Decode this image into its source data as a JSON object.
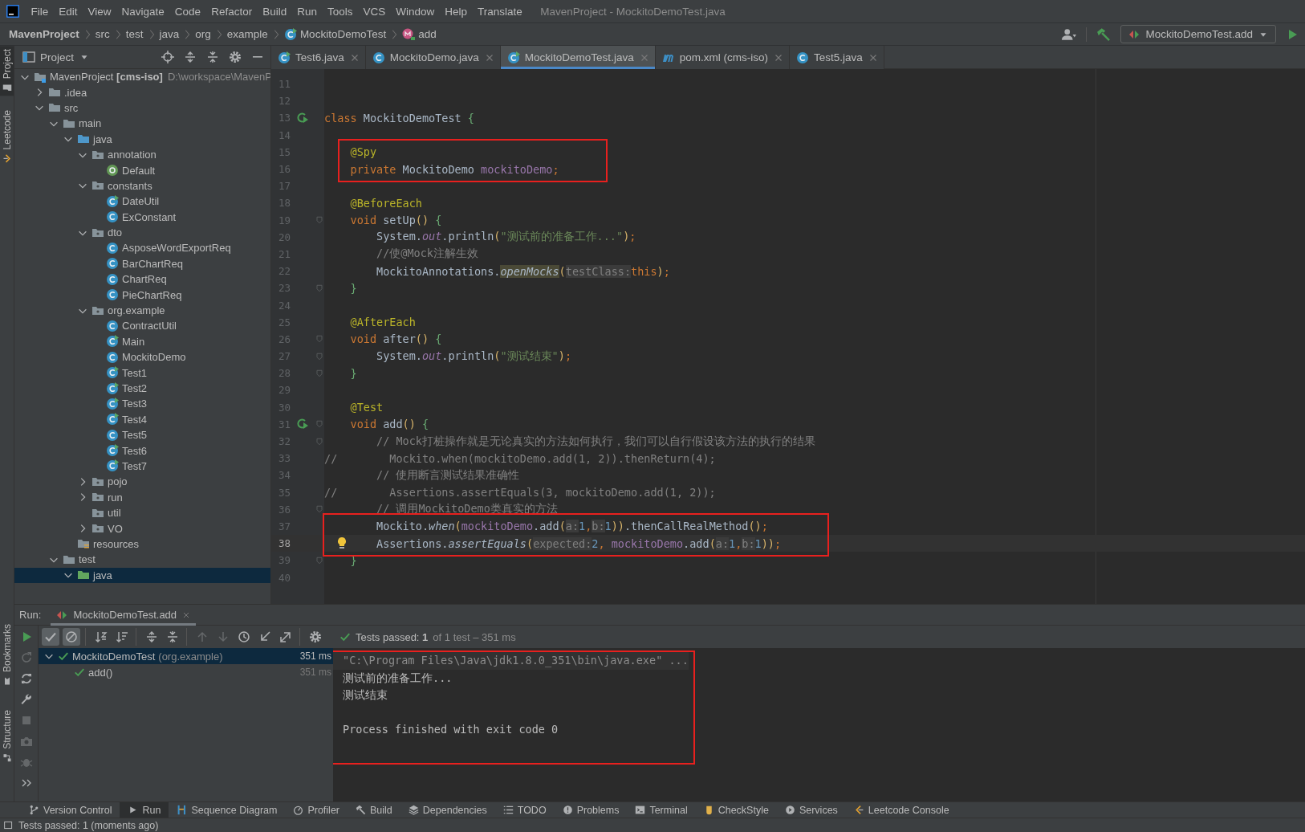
{
  "menu": {
    "items": [
      "File",
      "Edit",
      "View",
      "Navigate",
      "Code",
      "Refactor",
      "Build",
      "Run",
      "Tools",
      "VCS",
      "Window",
      "Help",
      "Translate"
    ],
    "title": "MavenProject - MockitoDemoTest.java"
  },
  "navbar": {
    "crumbs": [
      {
        "label": "MavenProject",
        "kind": "project"
      },
      {
        "label": "src",
        "kind": "folder"
      },
      {
        "label": "test",
        "kind": "folder"
      },
      {
        "label": "java",
        "kind": "folder"
      },
      {
        "label": "org",
        "kind": "folder"
      },
      {
        "label": "example",
        "kind": "folder"
      },
      {
        "label": "MockitoDemoTest",
        "kind": "class"
      },
      {
        "label": "add",
        "kind": "method"
      }
    ],
    "run_config": "MockitoDemoTest.add"
  },
  "side_strip": {
    "top": [
      {
        "label": "Project",
        "kind": "project",
        "selected": true
      },
      {
        "label": "Leetcode",
        "kind": "leetcode",
        "selected": false
      }
    ],
    "bottom": [
      {
        "label": "Bookmarks",
        "kind": "bookmark",
        "selected": false
      },
      {
        "label": "Structure",
        "kind": "structure",
        "selected": false
      }
    ]
  },
  "project": {
    "title": "Project",
    "tree": [
      {
        "label": "MavenProject **[cms-iso]**",
        "hint": "D:\\workspace\\MavenP",
        "kind": "module",
        "expanded": true,
        "selected": false,
        "children": [
          {
            "label": ".idea",
            "kind": "folder",
            "expanded": false,
            "selected": false
          },
          {
            "label": "src",
            "kind": "folder",
            "expanded": true,
            "selected": false,
            "children": [
              {
                "label": "main",
                "kind": "folder",
                "expanded": true,
                "selected": false,
                "children": [
                  {
                    "label": "java",
                    "kind": "source",
                    "expanded": true,
                    "selected": false,
                    "children": [
                      {
                        "label": "annotation",
                        "kind": "package",
                        "expanded": true,
                        "selected": false,
                        "children": [
                          {
                            "label": "Default",
                            "kind": "annotation",
                            "selected": false
                          }
                        ]
                      },
                      {
                        "label": "constants",
                        "kind": "package",
                        "expanded": true,
                        "selected": false,
                        "children": [
                          {
                            "label": "DateUtil",
                            "kind": "class",
                            "runnable": true,
                            "selected": false
                          },
                          {
                            "label": "ExConstant",
                            "kind": "class",
                            "runnable": false,
                            "selected": false
                          }
                        ]
                      },
                      {
                        "label": "dto",
                        "kind": "package",
                        "expanded": true,
                        "selected": false,
                        "children": [
                          {
                            "label": "AsposeWordExportReq",
                            "kind": "class",
                            "runnable": false,
                            "selected": false
                          },
                          {
                            "label": "BarChartReq",
                            "kind": "class",
                            "runnable": false,
                            "selected": false
                          },
                          {
                            "label": "ChartReq",
                            "kind": "class",
                            "runnable": false,
                            "selected": false
                          },
                          {
                            "label": "PieChartReq",
                            "kind": "class",
                            "runnable": false,
                            "selected": false
                          }
                        ]
                      },
                      {
                        "label": "org.example",
                        "kind": "package",
                        "expanded": true,
                        "selected": false,
                        "children": [
                          {
                            "label": "ContractUtil",
                            "kind": "class",
                            "runnable": false,
                            "selected": false
                          },
                          {
                            "label": "Main",
                            "kind": "class",
                            "runnable": true,
                            "selected": false
                          },
                          {
                            "label": "MockitoDemo",
                            "kind": "class",
                            "runnable": false,
                            "selected": false
                          },
                          {
                            "label": "Test1",
                            "kind": "class",
                            "runnable": true,
                            "selected": false
                          },
                          {
                            "label": "Test2",
                            "kind": "class",
                            "runnable": true,
                            "selected": false
                          },
                          {
                            "label": "Test3",
                            "kind": "class",
                            "runnable": true,
                            "selected": false
                          },
                          {
                            "label": "Test4",
                            "kind": "class",
                            "runnable": true,
                            "selected": false
                          },
                          {
                            "label": "Test5",
                            "kind": "class",
                            "runnable": false,
                            "selected": false
                          },
                          {
                            "label": "Test6",
                            "kind": "class",
                            "runnable": true,
                            "selected": false
                          },
                          {
                            "label": "Test7",
                            "kind": "class",
                            "runnable": true,
                            "selected": false
                          }
                        ]
                      },
                      {
                        "label": "pojo",
                        "kind": "package",
                        "expanded": false,
                        "selected": false
                      },
                      {
                        "label": "run",
                        "kind": "package",
                        "expanded": false,
                        "selected": false
                      },
                      {
                        "label": "util",
                        "kind": "package",
                        "selected": false
                      },
                      {
                        "label": "VO",
                        "kind": "package",
                        "expanded": false,
                        "selected": false
                      }
                    ]
                  },
                  {
                    "label": "resources",
                    "kind": "resources",
                    "selected": false
                  }
                ]
              },
              {
                "label": "test",
                "kind": "folder",
                "expanded": true,
                "selected": false,
                "children": [
                  {
                    "label": "java",
                    "kind": "test-source",
                    "expanded": true,
                    "selected": true
                  }
                ]
              }
            ]
          }
        ]
      }
    ]
  },
  "editor": {
    "tabs": [
      {
        "label": "Test6.java",
        "kind": "class-run",
        "selected": false
      },
      {
        "label": "MockitoDemo.java",
        "kind": "class",
        "selected": false
      },
      {
        "label": "MockitoDemoTest.java",
        "kind": "class-run",
        "selected": true
      },
      {
        "label": "pom.xml (cms-iso)",
        "kind": "maven",
        "selected": false
      },
      {
        "label": "Test5.java",
        "kind": "class",
        "selected": false
      }
    ],
    "lines": [
      {
        "number": "11",
        "current": false,
        "marked": false
      },
      {
        "number": "12",
        "current": false,
        "marked": false
      },
      {
        "number": "13",
        "current": false,
        "marked": false,
        "gutter": [
          {
            "kind": "run"
          }
        ],
        "tokens": [
          {
            "kind": "keyword",
            "text": "class"
          },
          {
            "kind": "plain",
            "text": " MockitoDemoTest "
          },
          {
            "kind": "brace",
            "text": "{"
          }
        ]
      },
      {
        "number": "14",
        "current": false,
        "marked": false
      },
      {
        "number": "15",
        "current": false,
        "marked": true,
        "tokens": [
          {
            "kind": "annotation",
            "text": "    @Spy"
          }
        ]
      },
      {
        "number": "16",
        "current": false,
        "marked": true,
        "tokens": [
          {
            "kind": "keyword",
            "text": "    private"
          },
          {
            "kind": "plain",
            "text": " MockitoDemo "
          },
          {
            "kind": "member",
            "text": "mockitoDemo"
          },
          {
            "kind": "keyword",
            "text": ";"
          }
        ]
      },
      {
        "number": "17",
        "current": false,
        "marked": false
      },
      {
        "number": "18",
        "current": false,
        "marked": false,
        "tokens": [
          {
            "kind": "annotation",
            "text": "    @BeforeEach"
          }
        ]
      },
      {
        "number": "19",
        "current": false,
        "marked": false,
        "gutter": [
          {
            "kind": "fold"
          }
        ],
        "tokens": [
          {
            "kind": "keyword",
            "text": "    void"
          },
          {
            "kind": "plain",
            "text": " setUp"
          },
          {
            "kind": "paren",
            "text": "()"
          },
          {
            "kind": "brace",
            "text": " {"
          }
        ]
      },
      {
        "number": "20",
        "current": false,
        "marked": false,
        "tokens": [
          {
            "kind": "plain",
            "text": "        System."
          },
          {
            "kind": "field",
            "text": "out"
          },
          {
            "kind": "plain",
            "text": ".println"
          },
          {
            "kind": "paren",
            "text": "("
          },
          {
            "kind": "string",
            "text": "\"测试前的准备工作...\""
          },
          {
            "kind": "paren",
            "text": ")"
          },
          {
            "kind": "keyword",
            "text": ";"
          }
        ]
      },
      {
        "number": "21",
        "current": false,
        "marked": false,
        "tokens": [
          {
            "kind": "comment",
            "text": "        //使@Mock注解生效"
          }
        ]
      },
      {
        "number": "22",
        "current": false,
        "marked": false,
        "tokens": [
          {
            "kind": "plain",
            "text": "        MockitoAnnotations."
          },
          {
            "kind": "usage",
            "text": "openMocks"
          },
          {
            "kind": "paren",
            "text": "("
          },
          {
            "kind": "hint",
            "text": "testClass:"
          },
          {
            "kind": "keyword",
            "text": "this"
          },
          {
            "kind": "paren",
            "text": ")"
          },
          {
            "kind": "keyword",
            "text": ";"
          }
        ]
      },
      {
        "number": "23",
        "current": false,
        "marked": false,
        "gutter": [
          {
            "kind": "fold"
          }
        ],
        "tokens": [
          {
            "kind": "brace",
            "text": "    }"
          }
        ]
      },
      {
        "number": "24",
        "current": false,
        "marked": false
      },
      {
        "number": "25",
        "current": false,
        "marked": false,
        "tokens": [
          {
            "kind": "annotation",
            "text": "    @AfterEach"
          }
        ]
      },
      {
        "number": "26",
        "current": false,
        "marked": false,
        "gutter": [
          {
            "kind": "fold"
          }
        ],
        "tokens": [
          {
            "kind": "keyword",
            "text": "    void"
          },
          {
            "kind": "plain",
            "text": " after"
          },
          {
            "kind": "paren",
            "text": "()"
          },
          {
            "kind": "brace",
            "text": " {"
          }
        ]
      },
      {
        "number": "27",
        "current": false,
        "marked": false,
        "gutter": [
          {
            "kind": "fold"
          }
        ],
        "tokens": [
          {
            "kind": "plain",
            "text": "        System."
          },
          {
            "kind": "field",
            "text": "out"
          },
          {
            "kind": "plain",
            "text": ".println"
          },
          {
            "kind": "paren",
            "text": "("
          },
          {
            "kind": "string",
            "text": "\"测试结束\""
          },
          {
            "kind": "paren",
            "text": ")"
          },
          {
            "kind": "keyword",
            "text": ";"
          }
        ]
      },
      {
        "number": "28",
        "current": false,
        "marked": false,
        "gutter": [
          {
            "kind": "fold"
          }
        ],
        "tokens": [
          {
            "kind": "brace",
            "text": "    }"
          }
        ]
      },
      {
        "number": "29",
        "current": false,
        "marked": false
      },
      {
        "number": "30",
        "current": false,
        "marked": false,
        "tokens": [
          {
            "kind": "annotation",
            "text": "    @Test"
          }
        ]
      },
      {
        "number": "31",
        "current": false,
        "marked": false,
        "gutter": [
          {
            "kind": "run"
          },
          {
            "kind": "fold"
          }
        ],
        "tokens": [
          {
            "kind": "keyword",
            "text": "    void"
          },
          {
            "kind": "plain",
            "text": " add"
          },
          {
            "kind": "paren",
            "text": "()"
          },
          {
            "kind": "brace",
            "text": " {"
          }
        ]
      },
      {
        "number": "32",
        "current": false,
        "marked": false,
        "gutter": [
          {
            "kind": "fold"
          }
        ],
        "tokens": [
          {
            "kind": "comment",
            "text": "        // Mock打桩操作就是无论真实的方法如何执行，我们可以自行假设该方法的执行的结果"
          }
        ]
      },
      {
        "number": "33",
        "current": false,
        "marked": false,
        "tokens": [
          {
            "kind": "comment",
            "text": "//        Mockito.when(mockitoDemo.add(1, 2)).thenReturn(4);"
          }
        ]
      },
      {
        "number": "34",
        "current": false,
        "marked": false,
        "tokens": [
          {
            "kind": "comment",
            "text": "        // 使用断言测试结果准确性"
          }
        ]
      },
      {
        "number": "35",
        "current": false,
        "marked": false,
        "tokens": [
          {
            "kind": "comment",
            "text": "//        Assertions.assertEquals(3, mockitoDemo.add(1, 2));"
          }
        ]
      },
      {
        "number": "36",
        "current": false,
        "marked": false,
        "gutter": [
          {
            "kind": "fold"
          }
        ],
        "tokens": [
          {
            "kind": "comment",
            "text": "        // 调用MockitoDemo类真实的方法"
          }
        ]
      },
      {
        "number": "37",
        "current": false,
        "marked": true,
        "tokens": [
          {
            "kind": "plain",
            "text": "        Mockito."
          },
          {
            "kind": "static-call",
            "text": "when"
          },
          {
            "kind": "paren",
            "text": "("
          },
          {
            "kind": "member",
            "text": "mockitoDemo"
          },
          {
            "kind": "plain",
            "text": ".add"
          },
          {
            "kind": "paren",
            "text": "("
          },
          {
            "kind": "hint",
            "text": "a:"
          },
          {
            "kind": "number",
            "text": "1"
          },
          {
            "kind": "keyword",
            "text": ","
          },
          {
            "kind": "hint",
            "text": "b:"
          },
          {
            "kind": "number",
            "text": "1"
          },
          {
            "kind": "paren",
            "text": "))"
          },
          {
            "kind": "plain",
            "text": ".thenCallRealMethod"
          },
          {
            "kind": "paren",
            "text": "()"
          },
          {
            "kind": "keyword",
            "text": ";"
          }
        ]
      },
      {
        "number": "38",
        "current": true,
        "marked": true,
        "gutter": [
          {
            "kind": "bulb"
          }
        ],
        "tokens": [
          {
            "kind": "plain",
            "text": "        Assertions."
          },
          {
            "kind": "static-call",
            "text": "assertEquals"
          },
          {
            "kind": "paren",
            "text": "("
          },
          {
            "kind": "hint",
            "text": "expected:"
          },
          {
            "kind": "number",
            "text": "2"
          },
          {
            "kind": "keyword",
            "text": ","
          },
          {
            "kind": "member",
            "text": " mockitoDemo"
          },
          {
            "kind": "plain",
            "text": ".add"
          },
          {
            "kind": "paren",
            "text": "("
          },
          {
            "kind": "hint",
            "text": "a:"
          },
          {
            "kind": "number",
            "text": "1"
          },
          {
            "kind": "keyword",
            "text": ","
          },
          {
            "kind": "hint",
            "text": "b:"
          },
          {
            "kind": "number",
            "text": "1"
          },
          {
            "kind": "paren",
            "text": "))"
          },
          {
            "kind": "keyword",
            "text": ";"
          }
        ]
      },
      {
        "number": "39",
        "current": false,
        "marked": false,
        "gutter": [
          {
            "kind": "fold"
          }
        ],
        "tokens": [
          {
            "kind": "brace",
            "text": "    }"
          }
        ]
      },
      {
        "number": "40",
        "current": false,
        "marked": false
      }
    ]
  },
  "run": {
    "label": "Run:",
    "tab": "MockitoDemoTest.add",
    "side_tools": [
      {
        "kind": "play",
        "disabled": false
      },
      {
        "kind": "rerun-failed",
        "disabled": true
      },
      {
        "kind": "sync",
        "disabled": false
      },
      {
        "kind": "wrench",
        "disabled": false
      },
      {
        "kind": "stop",
        "disabled": true
      },
      {
        "kind": "camera",
        "disabled": true
      },
      {
        "kind": "bug",
        "disabled": true
      },
      {
        "kind": "more",
        "disabled": false
      }
    ],
    "toolbar_groups": [
      [
        {
          "kind": "check",
          "on": true,
          "disabled": false
        },
        {
          "kind": "cancel",
          "on": true,
          "disabled": false
        }
      ],
      [
        {
          "kind": "sort-alpha",
          "on": false,
          "disabled": false
        },
        {
          "kind": "sort-duration",
          "on": false,
          "disabled": false
        }
      ],
      [
        {
          "kind": "expand-all",
          "on": false,
          "disabled": false
        },
        {
          "kind": "collapse-all",
          "on": false,
          "disabled": false
        }
      ],
      [
        {
          "kind": "up",
          "on": false,
          "disabled": true
        },
        {
          "kind": "down",
          "on": false,
          "disabled": true
        },
        {
          "kind": "clock",
          "on": false,
          "disabled": false
        },
        {
          "kind": "import",
          "on": false,
          "disabled": false
        },
        {
          "kind": "export",
          "on": false,
          "disabled": false
        }
      ],
      [
        {
          "kind": "gear",
          "on": false,
          "disabled": false
        }
      ]
    ],
    "summary": "Tests passed: **1**",
    "summary_detail": "of 1 test – 351 ms",
    "tests": [
      {
        "label": "MockitoDemoTest",
        "detail": "(org.example)",
        "time": "351 ms",
        "passed": true,
        "expanded": true,
        "selected": true,
        "children": [
          {
            "label": "add()",
            "time": "351 ms",
            "passed": true,
            "selected": false
          }
        ]
      }
    ],
    "console": {
      "marked": true,
      "lines": [
        {
          "kind": "command",
          "text": "\"C:\\Program Files\\Java\\jdk1.8.0_351\\bin\\java.exe\" ..."
        },
        {
          "kind": "output",
          "text": "测试前的准备工作..."
        },
        {
          "kind": "output",
          "text": "测试结束"
        },
        {
          "kind": "exit",
          "text": "Process finished with exit code 0"
        }
      ]
    }
  },
  "tool_windows": [
    {
      "label": "Version Control",
      "kind": "vcs",
      "selected": false
    },
    {
      "label": "Run",
      "kind": "play-gray",
      "selected": true
    },
    {
      "label": "Sequence Diagram",
      "kind": "sequence",
      "selected": false
    },
    {
      "label": "Profiler",
      "kind": "profiler",
      "selected": false
    },
    {
      "label": "Build",
      "kind": "hammer-gray",
      "selected": false
    },
    {
      "label": "Dependencies",
      "kind": "dependencies",
      "selected": false
    },
    {
      "label": "TODO",
      "kind": "todo",
      "selected": false
    },
    {
      "label": "Problems",
      "kind": "problems",
      "selected": false
    },
    {
      "label": "Terminal",
      "kind": "terminal",
      "selected": false
    },
    {
      "label": "CheckStyle",
      "kind": "checkstyle",
      "selected": false
    },
    {
      "label": "Services",
      "kind": "services",
      "selected": false
    },
    {
      "label": "Leetcode Console",
      "kind": "leetcode",
      "selected": false
    }
  ],
  "status": "Tests passed: 1 (moments ago)"
}
